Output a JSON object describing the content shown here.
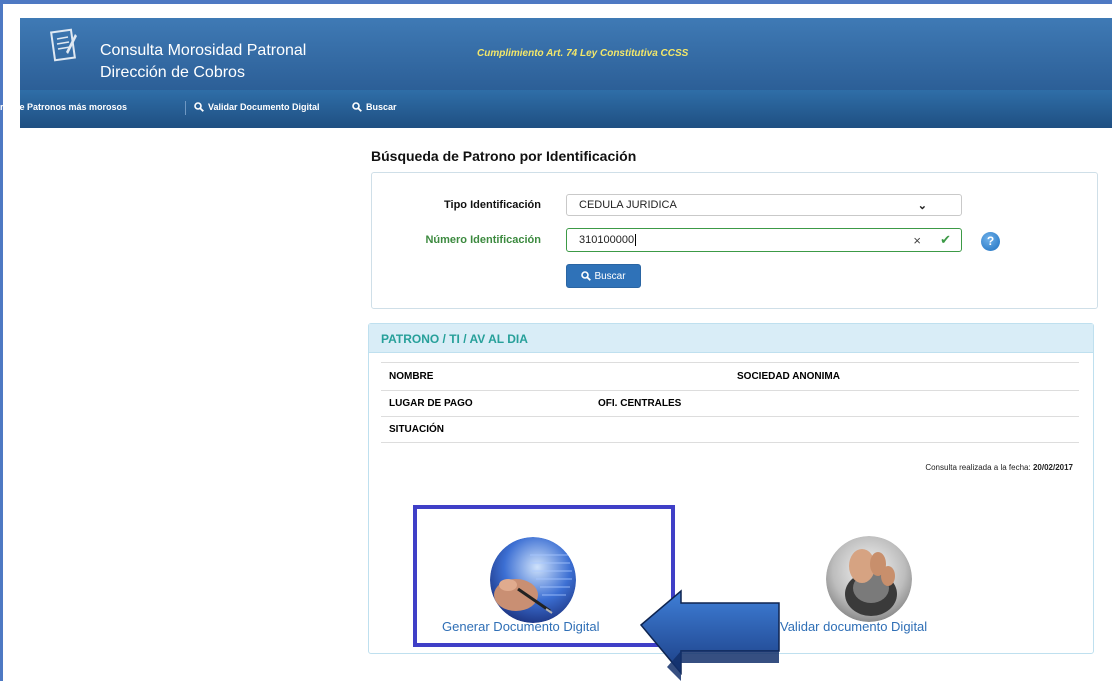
{
  "header": {
    "title": "Consulta Morosidad Patronal",
    "department": "Dirección de Cobros",
    "subtitle": "Cumplimiento Art. 74 Ley Constitutiva CCSS"
  },
  "nav": {
    "items": [
      {
        "label": "rte de Patronos más morosos",
        "icon": null
      },
      {
        "label": "Validar Documento Digital",
        "icon": "search-icon"
      },
      {
        "label": "Buscar",
        "icon": "search-icon"
      }
    ]
  },
  "search": {
    "title": "Búsqueda de Patrono por Identificación",
    "tipo_label": "Tipo Identificación",
    "tipo_value": "CEDULA JURIDICA",
    "numero_label": "Número Identificación",
    "numero_value": "310100000",
    "button_label": "Buscar"
  },
  "result": {
    "header": "PATRONO / TI / AV AL DIA",
    "rows": [
      {
        "label": "NOMBRE",
        "value": "SOCIEDAD ANONIMA"
      },
      {
        "label": "LUGAR DE PAGO",
        "value": "OFI. CENTRALES"
      },
      {
        "label": "SITUACIÓN",
        "value": ""
      }
    ],
    "consulta_prefix": "Consulta realizada a la fecha:",
    "consulta_date": "20/02/2017",
    "options": [
      {
        "label": "Generar Documento Digital",
        "icon": "pen-document-icon"
      },
      {
        "label": "Validar documento Digital",
        "icon": "mouse-hand-icon"
      }
    ]
  },
  "colors": {
    "header_bg": "#2c5f97",
    "subtitle": "#f3e76a",
    "accent_link": "#2f6fb6",
    "panel_title": "#27a09a",
    "highlight_box": "#3f3fc7"
  }
}
